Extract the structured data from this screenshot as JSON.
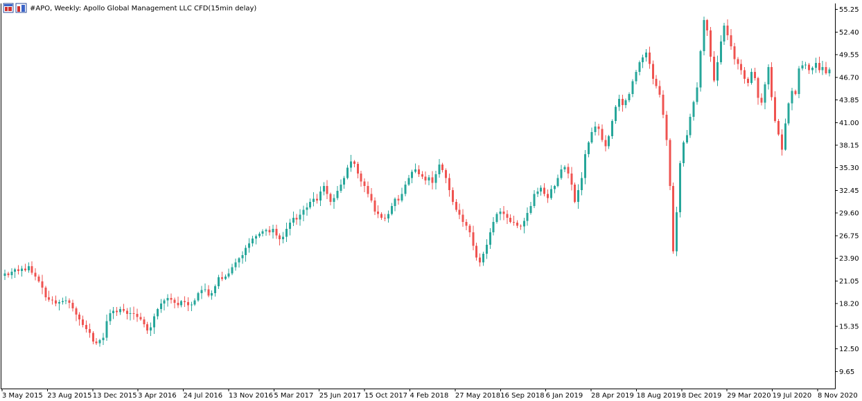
{
  "header": {
    "title": "#APO, Weekly:  Apollo Global Management LLC CFD(15min delay)",
    "icon_left": "chart-window-icon",
    "icon_right": "price-data-icon"
  },
  "colors": {
    "up": "#26a69a",
    "down": "#ef5350",
    "axis": "#000000",
    "background": "#ffffff"
  },
  "chart_data": {
    "type": "candlestick",
    "title": "#APO, Weekly:  Apollo Global Management LLC CFD(15min delay)",
    "ylim": [
      7.5,
      56.0
    ],
    "y_ticks": [
      "55.25",
      "52.40",
      "49.55",
      "46.70",
      "43.85",
      "41.00",
      "38.15",
      "35.30",
      "32.45",
      "29.60",
      "26.75",
      "23.90",
      "21.05",
      "18.20",
      "15.35",
      "12.50",
      "9.65"
    ],
    "x_ticks": [
      "3 May 2015",
      "23 Aug 2015",
      "13 Dec 2015",
      "3 Apr 2016",
      "24 Jul 2016",
      "13 Nov 2016",
      "5 Mar 2017",
      "25 Jun 2017",
      "15 Oct 2017",
      "4 Feb 2018",
      "27 May 2018",
      "16 Sep 2018",
      "6 Jan 2019",
      "28 Apr 2019",
      "18 Aug 2019",
      "8 Dec 2019",
      "29 Mar 2020",
      "19 Jul 2020",
      "8 Nov 2020"
    ],
    "grid": false,
    "series": [
      {
        "values": [
          22.0,
          21.8,
          22.2,
          22.5,
          22.3,
          22.6,
          22.4,
          22.9,
          22.1,
          21.6,
          21.0,
          20.2,
          19.0,
          18.7,
          18.6,
          18.2,
          18.4,
          18.5,
          18.6,
          18.3,
          17.6,
          16.8,
          16.2,
          15.5,
          15.0,
          14.5,
          13.4,
          13.2,
          13.6,
          13.9,
          16.0,
          17.0,
          17.3,
          17.1,
          17.5,
          17.3,
          16.9,
          17.0,
          16.9,
          16.5,
          16.2,
          15.6,
          14.8,
          15.2,
          16.6,
          17.5,
          18.2,
          18.6,
          18.9,
          18.7,
          18.3,
          18.0,
          18.5,
          18.4,
          18.0,
          18.1,
          18.6,
          19.5,
          19.9,
          20.0,
          19.2,
          19.5,
          20.4,
          21.5,
          21.3,
          21.6,
          22.0,
          22.8,
          23.4,
          23.9,
          24.3,
          25.2,
          25.8,
          26.4,
          26.7,
          27.0,
          27.3,
          27.5,
          27.2,
          27.6,
          26.8,
          26.3,
          26.6,
          27.6,
          28.4,
          29.0,
          28.8,
          29.4,
          30.0,
          30.3,
          31.0,
          31.4,
          31.2,
          32.3,
          33.0,
          32.0,
          31.0,
          31.5,
          32.4,
          33.2,
          34.0,
          35.3,
          36.1,
          35.8,
          34.6,
          33.6,
          33.0,
          32.0,
          31.2,
          29.8,
          29.5,
          29.0,
          28.9,
          29.5,
          30.5,
          31.4,
          31.2,
          32.0,
          33.2,
          34.0,
          34.8,
          35.1,
          34.5,
          34.2,
          33.7,
          34.1,
          33.4,
          34.5,
          35.7,
          35.0,
          34.0,
          32.5,
          31.0,
          30.0,
          29.4,
          28.5,
          28.0,
          27.2,
          25.5,
          24.0,
          23.4,
          24.5,
          25.6,
          27.2,
          28.5,
          29.5,
          29.8,
          29.5,
          29.0,
          28.5,
          28.4,
          28.0,
          27.9,
          28.6,
          29.6,
          30.5,
          32.0,
          32.3,
          32.8,
          32.0,
          31.5,
          32.6,
          33.0,
          34.0,
          35.1,
          35.4,
          34.6,
          33.2,
          31.0,
          32.5,
          34.0,
          37.0,
          38.5,
          39.8,
          40.5,
          40.2,
          38.8,
          38.0,
          39.3,
          41.2,
          43.0,
          44.0,
          43.2,
          43.8,
          44.6,
          46.2,
          47.4,
          48.6,
          49.2,
          49.8,
          48.4,
          46.5,
          45.6,
          44.5,
          42.0,
          38.8,
          33.0,
          24.8,
          29.7,
          35.9,
          38.5,
          39.4,
          41.7,
          43.6,
          45.4,
          50.0,
          53.9,
          52.6,
          49.3,
          46.3,
          48.6,
          51.2,
          53.2,
          52.0,
          50.6,
          49.0,
          48.4,
          47.6,
          46.5,
          46.0,
          47.4,
          46.6,
          44.1,
          43.5,
          45.8,
          48.0,
          44.2,
          41.2,
          39.5,
          37.6,
          40.9,
          43.4,
          45.0,
          44.6,
          47.8,
          48.2,
          48.3,
          47.6,
          47.9,
          48.5,
          47.6,
          48.0,
          47.2,
          47.7
        ],
        "open": null
      }
    ]
  }
}
